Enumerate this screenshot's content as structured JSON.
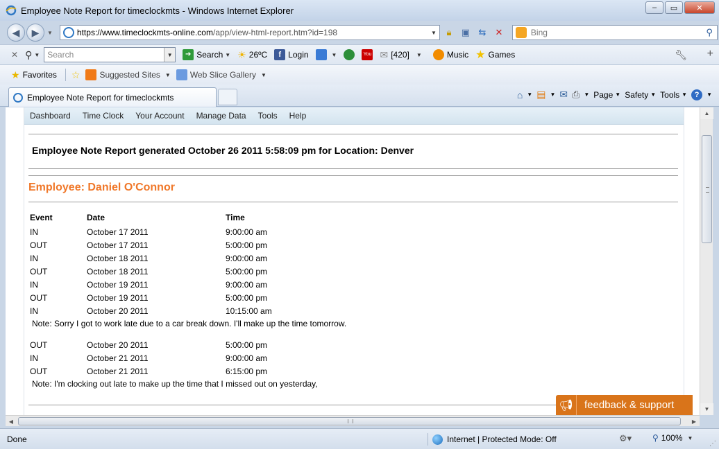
{
  "window": {
    "title": "Employee Note Report for timeclockmts - Windows Internet Explorer",
    "minimize": "–",
    "maximize": "▭",
    "close": "✕"
  },
  "address_bar": {
    "url_host": "https://www.timeclockmts-online.com",
    "url_path": "/app/view-html-report.htm?id=198",
    "search_placeholder": "Bing"
  },
  "toolbar": {
    "search_placeholder": "Search",
    "search_label": "Search",
    "weather": "26ºC",
    "login": "Login",
    "notifications": "[420]",
    "music": "Music",
    "games": "Games",
    "youtube": "You"
  },
  "favorites_bar": {
    "favorites": "Favorites",
    "suggested_sites": "Suggested Sites",
    "web_slice_gallery": "Web Slice Gallery"
  },
  "tab": {
    "label": "Employee Note Report for timeclockmts"
  },
  "command_bar": {
    "page": "Page",
    "safety": "Safety",
    "tools": "Tools"
  },
  "site_menu": [
    "Dashboard",
    "Time Clock",
    "Your Account",
    "Manage Data",
    "Tools",
    "Help"
  ],
  "report": {
    "title": "Employee Note Report generated October 26 2011 5:58:09 pm for Location: Denver",
    "employee": "Employee: Daniel O'Connor",
    "columns": [
      "Event",
      "Date",
      "Time"
    ],
    "rows_a": [
      [
        "IN",
        "October 17 2011",
        "9:00:00 am"
      ],
      [
        "OUT",
        "October 17 2011",
        "5:00:00 pm"
      ],
      [
        "IN",
        "October 18 2011",
        "9:00:00 am"
      ],
      [
        "OUT",
        "October 18 2011",
        "5:00:00 pm"
      ],
      [
        "IN",
        "October 19 2011",
        "9:00:00 am"
      ],
      [
        "OUT",
        "October 19 2011",
        "5:00:00 pm"
      ],
      [
        "IN",
        "October 20 2011",
        "10:15:00 am"
      ]
    ],
    "note_a": "Note: Sorry I got to work late due to a car break down. I'll make up the time tomorrow.",
    "rows_b": [
      [
        "OUT",
        "October 20 2011",
        "5:00:00 pm"
      ],
      [
        "IN",
        "October 21 2011",
        "9:00:00 am"
      ],
      [
        "OUT",
        "October 21 2011",
        "6:15:00 pm"
      ]
    ],
    "note_b": "Note: I'm clocking out late to make up the time that I missed out on yesterday,"
  },
  "feedback": {
    "label": "feedback & support"
  },
  "status_bar": {
    "status": "Done",
    "zone": "Internet | Protected Mode: Off",
    "zoom": "100%"
  }
}
